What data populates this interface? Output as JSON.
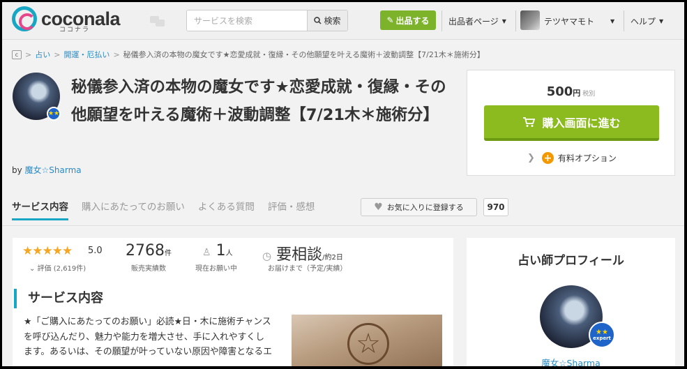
{
  "header": {
    "logo_text": "coconala",
    "logo_kana": "ココナラ",
    "search_placeholder": "サービスを検索",
    "search_button": "検索",
    "sell_button": "出品する",
    "seller_page": "出品者ページ",
    "user_name": "テツヤマモト",
    "help": "ヘルプ"
  },
  "breadcrumb": {
    "items": [
      "占い",
      "開運・厄払い"
    ],
    "current": "秘儀参入済の本物の魔女です★恋愛成就・復縁・その他願望を叶える魔術＋波動調整【7/21木＊施術分】"
  },
  "service": {
    "title": "秘儀参入済の本物の魔女です★恋愛成就・復縁・その他願望を叶える魔術＋波動調整【7/21木＊施術分】",
    "by": "by",
    "seller": "魔女☆Sharma"
  },
  "purchase": {
    "price": "500",
    "yen": "円",
    "tax": "税別",
    "buy_button": "購入画面に進む",
    "paid_option": "有料オプション"
  },
  "tabs": {
    "items": [
      "サービス内容",
      "購入にあたってのお願い",
      "よくある質問",
      "評価・感想"
    ],
    "favorite_button": "お気に入りに登録する",
    "favorite_count": "970"
  },
  "stats": {
    "stars": "★★★★★",
    "rating": "5.0",
    "rating_count": "評価 (2,619件)",
    "sales": "2768",
    "sales_unit": "件",
    "sales_label": "販売実績数",
    "requests": "1",
    "requests_unit": "人",
    "requests_label": "現在お願い中",
    "delivery": "要相談",
    "delivery_est": "/約2日",
    "delivery_label": "お届けまで（予定/実績）"
  },
  "description": {
    "heading": "サービス内容",
    "text": "★「ご購入にあたってのお願い」必読★日・木に施術チャンスを呼び込んだり、魅力や能力を増大させ、手に入れやすくします。あるいは、その願望が叶っていない原因や障害となるエ"
  },
  "profile": {
    "title": "占い師プロフィール",
    "badge": "expert",
    "name": "魔女☆Sharma"
  }
}
